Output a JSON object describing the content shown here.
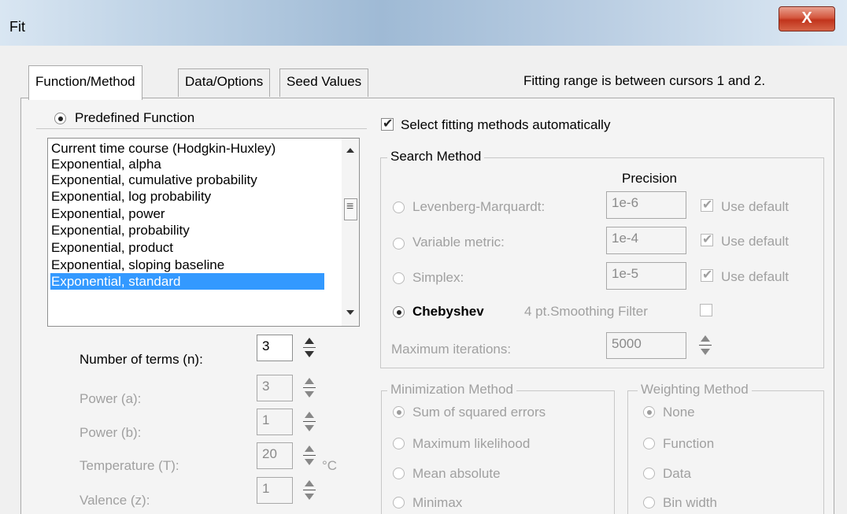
{
  "window": {
    "title": "Fit",
    "close_glyph": "X"
  },
  "tabs": [
    {
      "label": "Function/Method",
      "active": true
    },
    {
      "label": "Data/Options",
      "active": false
    },
    {
      "label": "Seed Values",
      "active": false
    }
  ],
  "fitting_range_note": "Fitting range is between cursors 1 and 2.",
  "predefined": {
    "radio_label": "Predefined Function",
    "selected": true,
    "functions": [
      "Current time course (Hodgkin-Huxley)",
      "Exponential, alpha",
      "Exponential, cumulative probability",
      "Exponential, log probability",
      "Exponential, power",
      "Exponential, probability",
      "Exponential, product",
      "Exponential, sloping baseline",
      "Exponential, standard"
    ],
    "selected_function": "Exponential, standard"
  },
  "params": {
    "terms": {
      "label": "Number of terms (n):",
      "value": "3"
    },
    "power_a": {
      "label": "Power (a):",
      "value": "3"
    },
    "power_b": {
      "label": "Power (b):",
      "value": "1"
    },
    "temperature": {
      "label": "Temperature (T):",
      "value": "20",
      "unit": "°C"
    },
    "valence": {
      "label": "Valence (z):",
      "value": "1"
    }
  },
  "auto_select": {
    "label": "Select fitting methods automatically",
    "checked": true
  },
  "search_method": {
    "legend": "Search Method",
    "precision_header": "Precision",
    "methods": [
      {
        "label": "Levenberg-Marquardt:",
        "precision": "1e-6",
        "use_default": "Use default"
      },
      {
        "label": "Variable metric:",
        "precision": "1e-4",
        "use_default": "Use default"
      },
      {
        "label": "Simplex:",
        "precision": "1e-5",
        "use_default": "Use default"
      }
    ],
    "chebyshev": {
      "label": "Chebyshev",
      "selected": true
    },
    "smoothing_label": "4 pt.Smoothing Filter",
    "max_iter_label": "Maximum iterations:",
    "max_iter_value": "5000"
  },
  "minimization": {
    "legend": "Minimization Method",
    "options": [
      "Sum of squared errors",
      "Maximum likelihood",
      "Mean absolute",
      "Minimax"
    ],
    "selected": "Sum of squared errors"
  },
  "weighting": {
    "legend": "Weighting Method",
    "options": [
      "None",
      "Function",
      "Data",
      "Bin width"
    ],
    "selected": "None"
  }
}
